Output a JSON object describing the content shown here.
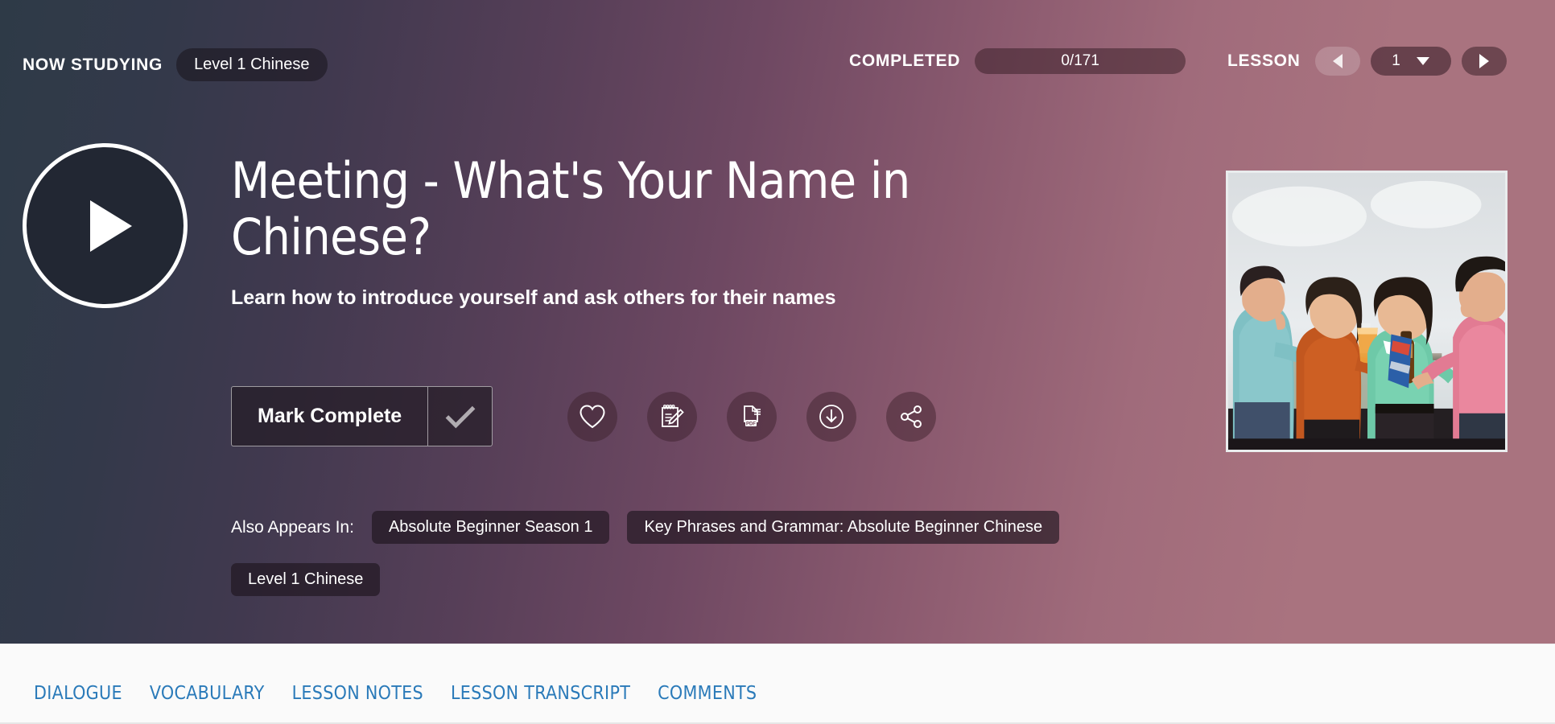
{
  "header": {
    "now_studying_label": "NOW STUDYING",
    "course_pill": "Level 1 Chinese",
    "completed_label": "COMPLETED",
    "completed_value": "0/171",
    "completed_done": 0,
    "completed_total": 171,
    "lesson_label": "LESSON",
    "lesson_number": "1",
    "prev_icon": "triangle-left-icon",
    "next_icon": "triangle-right-icon",
    "caret_icon": "chevron-down-icon"
  },
  "hero": {
    "play_icon": "play-icon",
    "title": "Meeting - What's Your Name in Chinese?",
    "subtitle": "Learn how to introduce yourself and ask others for their names",
    "gradient_start": "#2e3a47",
    "gradient_end": "#a9737f"
  },
  "actions": {
    "mark_complete_label": "Mark Complete",
    "check_icon": "check-icon",
    "icon_buttons": [
      {
        "name": "favorite-icon",
        "title": "Favorite"
      },
      {
        "name": "lesson-notes-icon",
        "title": "Lesson Notes"
      },
      {
        "name": "pdf-icon",
        "title": "PDF",
        "badge": "PDF"
      },
      {
        "name": "download-icon",
        "title": "Download"
      },
      {
        "name": "share-icon",
        "title": "Share"
      }
    ]
  },
  "also_appears_in": {
    "label": "Also Appears In:",
    "tags": [
      "Absolute Beginner Season 1",
      "Key Phrases and Grammar: Absolute Beginner Chinese",
      "Level 1 Chinese"
    ]
  },
  "thumbnail": {
    "alt": "Four friends socializing with drinks on a rooftop terrace"
  },
  "footer": {
    "tabs": [
      "DIALOGUE",
      "VOCABULARY",
      "LESSON NOTES",
      "LESSON TRANSCRIPT",
      "COMMENTS"
    ],
    "tab_color": "#2a7ab9"
  }
}
